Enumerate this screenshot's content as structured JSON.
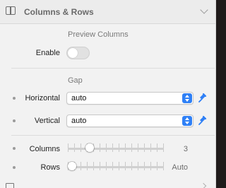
{
  "panel": {
    "header": {
      "title": "Columns & Rows",
      "icon": "columns-panel-icon",
      "chevron_icon": "chevron-down-icon"
    },
    "preview_columns": {
      "title": "Preview Columns",
      "enable_label": "Enable",
      "enabled": false
    },
    "gap": {
      "title": "Gap",
      "horizontal": {
        "label": "Horizontal",
        "value": "auto",
        "stepper_icon": "up-down-chevrons-icon",
        "pin_icon": "pin-icon"
      },
      "vertical": {
        "label": "Vertical",
        "value": "auto",
        "stepper_icon": "up-down-chevrons-icon",
        "pin_icon": "pin-icon"
      }
    },
    "grid": {
      "columns": {
        "label": "Columns",
        "value": "3",
        "slider_fraction": 0.2
      },
      "rows": {
        "label": "Rows",
        "value": "Auto",
        "slider_fraction": 0
      }
    }
  },
  "colors": {
    "accent": "#2f80f6",
    "panel_bg": "#f2f2f2"
  }
}
